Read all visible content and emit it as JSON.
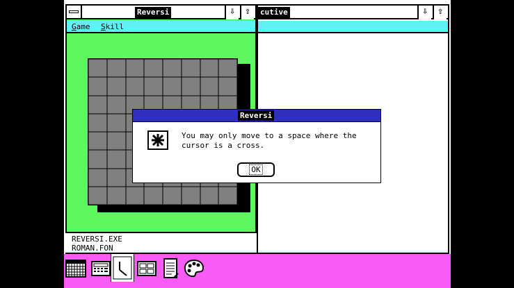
{
  "reversi_window": {
    "title": "Reversi",
    "menu": [
      {
        "label": "Game",
        "accel": "G",
        "rest": "ame"
      },
      {
        "label": "Skill",
        "accel": "S",
        "rest": "kill"
      }
    ],
    "bg_color": "#5ef75e"
  },
  "executive_window": {
    "title_fragment": "cutive",
    "files": [
      "REVERSI.EXE",
      "ROMAN.FON"
    ]
  },
  "dialog": {
    "title": "Reversi",
    "icon": "asterisk-icon",
    "message_line1": "You may only move to a space where the",
    "message_line2": "cursor is a cross.",
    "ok_label": "OK"
  },
  "icon_area": {
    "bg_color": "#f85cf5",
    "icons": [
      "calendar-icon",
      "calculator-icon",
      "clock-icon",
      "cardfile-icon",
      "notepad-icon",
      "paint-icon"
    ]
  },
  "colors": {
    "menu_bar": "#5ef2f5",
    "dialog_title": "#3030c0",
    "board": "#808080"
  }
}
